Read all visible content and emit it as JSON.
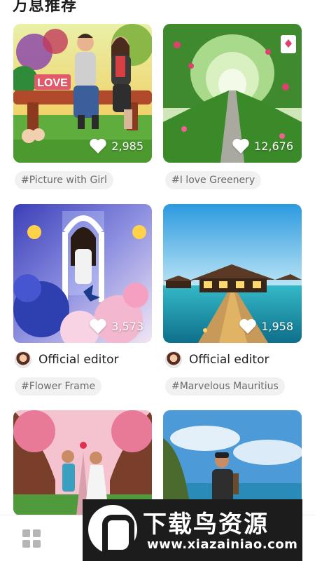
{
  "section": {
    "title": "万息推荐"
  },
  "cards": [
    {
      "likes": "2,985",
      "tag": "#Picture with Girl",
      "author": ""
    },
    {
      "likes": "12,676",
      "tag": "#I love Greenery",
      "author": ""
    },
    {
      "likes": "3,573",
      "tag": "#Flower Frame",
      "author": "Official editor"
    },
    {
      "likes": "1,958",
      "tag": "#Marvelous Mauritius",
      "author": "Official editor"
    }
  ],
  "love_sign": "LOVE",
  "watermark": {
    "cn": "下载鸟资源",
    "url": "www.xiazainiao.com"
  },
  "icons": [
    "heart-icon",
    "grid-icon",
    "avatar"
  ],
  "colors": {
    "tag_bg": "#f1f1f1",
    "tag_text": "#6b6b6b",
    "title": "#1a1a1a"
  }
}
